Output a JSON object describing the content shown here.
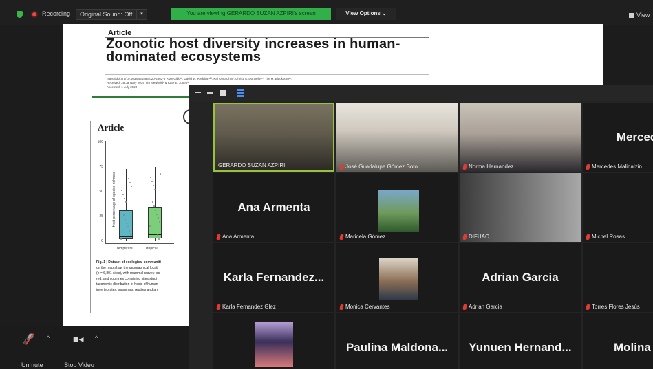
{
  "topbar": {
    "recording_label": "Recording",
    "original_sound": "Original Sound: Off",
    "original_sound_caret": "▾",
    "viewing_banner": "You are viewing GERARDO SUZAN AZPIRI's screen",
    "view_options": "View Options ⌄",
    "view_right": "View",
    "colors": {
      "banner": "#31b04a",
      "recording": "#e8483f",
      "shield": "#3bb54a"
    }
  },
  "document": {
    "article_label": "Article",
    "title": "Zoonotic host diversity increases in human-dominated ecosystems",
    "meta_lines": [
      "https://doi.org/10.1038/s41586-020-2562-8     Rory Gibb¹², David W. Redding¹²³, Kai Qing Chin¹, Christl A. Donnelly⁴⁵, Tim M. Blackburn¹⁶,",
      "Received: 28 January 2019                       Tim Newbold¹ & Kate E. Jones¹²",
      "Accepted: 1 July 2020"
    ],
    "article_label_2": "Article",
    "chart_data": {
      "type": "box",
      "ylabel": "Host percentage of species richness",
      "yticks": [
        "100",
        "75",
        "50",
        "25",
        "0"
      ],
      "ylim": [
        0,
        100
      ],
      "categories": [
        "Temperate",
        "Tropical"
      ],
      "boxes": [
        {
          "name": "Temperate",
          "min": 0,
          "q1": 2,
          "median": 5,
          "q3": 31,
          "max": 73,
          "color": "#5fb6c4"
        },
        {
          "name": "Tropical",
          "min": 0,
          "q1": 3,
          "median": 7,
          "q3": 35,
          "max": 75,
          "color": "#7ccf7a"
        }
      ]
    },
    "caption_bold": "Fig. 1 | Dataset of ecological communiti",
    "caption_lines": [
      "on the map show the geographical locati",
      "(n = 6,801 sites), with mammal survey loc",
      "red, and countries containing sites studi",
      "taxonomic distribution of hosts of human",
      "invertebrates, mammals, reptiles and am"
    ]
  },
  "toolbar": {
    "unmute_label": "Unmute",
    "stop_video_label": "Stop Video",
    "caret": "^"
  },
  "gallery": {
    "participants": [
      {
        "name": "GERARDO SUZAN AZPIRI",
        "muted": false,
        "video": true,
        "active": true
      },
      {
        "name": "José Guadalupe Gómez Soto",
        "muted": true,
        "video": true
      },
      {
        "name": "Norma Hernandez",
        "muted": true,
        "video": true
      },
      {
        "big_name": "Mercedes",
        "name": "Mercedes Malinalzin",
        "muted": true,
        "video": false
      },
      {
        "big_name": "Ana Armenta",
        "name": "Ana Armenta",
        "muted": true,
        "video": false
      },
      {
        "name": "Maricela Gómez",
        "muted": true,
        "video": true
      },
      {
        "name": "DIFUAC",
        "muted": true,
        "video": true
      },
      {
        "name": "Michel Rosas",
        "muted": true,
        "video": true
      },
      {
        "big_name": "Karla  Fernandez...",
        "name": "Karla Fernandez Glez",
        "muted": true,
        "video": false
      },
      {
        "name": "Monica Cervantes",
        "muted": true,
        "video": true
      },
      {
        "big_name": "Adrian Garcia",
        "name": "Adrian Garcia",
        "muted": true,
        "video": false
      },
      {
        "name": "Torres Flores Jesús",
        "muted": true,
        "video": true
      },
      {
        "name": "",
        "muted": false,
        "video": true
      },
      {
        "big_name": "Paulina  Maldona...",
        "name": "",
        "muted": false,
        "video": false
      },
      {
        "big_name": "Yunuen  Hernand...",
        "name": "",
        "muted": false,
        "video": false
      },
      {
        "big_name": "Molina  Rol",
        "name": "",
        "muted": false,
        "video": false
      }
    ]
  }
}
